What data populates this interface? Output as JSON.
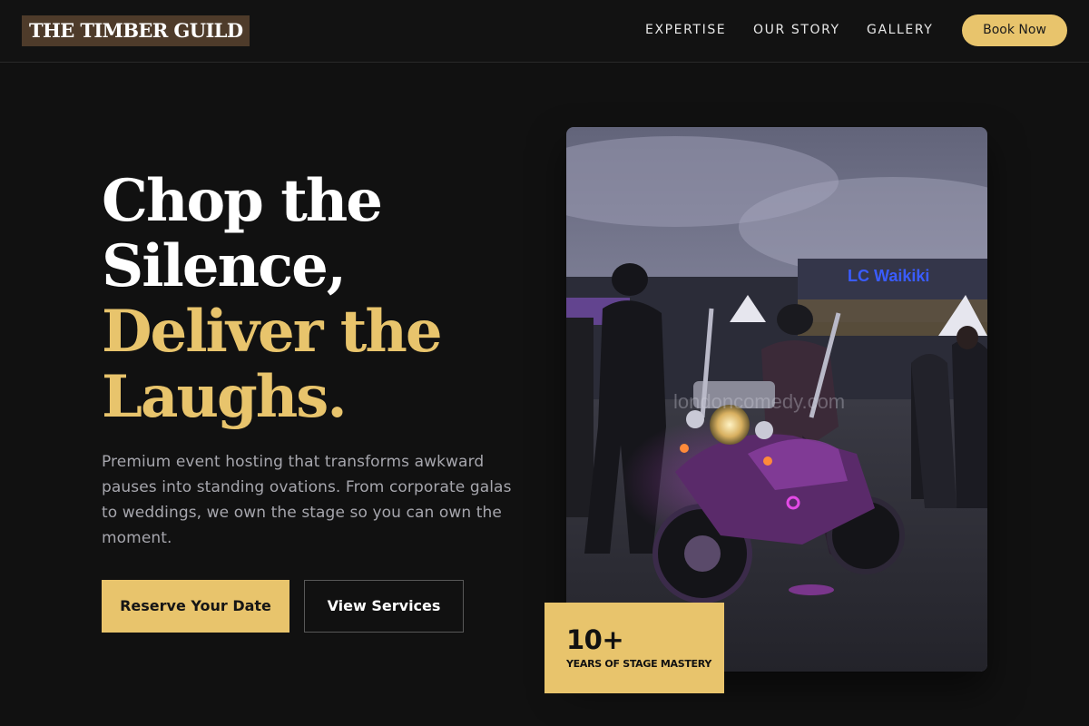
{
  "header": {
    "logo": "THE TIMBER GUILD",
    "nav": [
      {
        "label": "EXPERTISE"
      },
      {
        "label": "OUR STORY"
      },
      {
        "label": "GALLERY"
      }
    ],
    "cta_label": "Book Now"
  },
  "hero": {
    "headline_line1": "Chop the",
    "headline_line2": "Silence,",
    "headline_line3": "Deliver the",
    "headline_line4": "Laughs.",
    "subcopy": "Premium event hosting that transforms awkward pauses into standing ovations. From corporate galas to weddings, we own the stage so you can own the moment.",
    "primary_button": "Reserve Your Date",
    "secondary_button": "View Services"
  },
  "photo": {
    "sign_text": "LC Waikiki",
    "watermark": "londoncomedy.com"
  },
  "stat": {
    "number": "10+",
    "label": "YEARS OF STAGE MASTERY"
  },
  "colors": {
    "background": "#111111",
    "accent": "#e8c46c",
    "logo_bg": "#4e3b2a",
    "muted_text": "#a6a6ad"
  }
}
